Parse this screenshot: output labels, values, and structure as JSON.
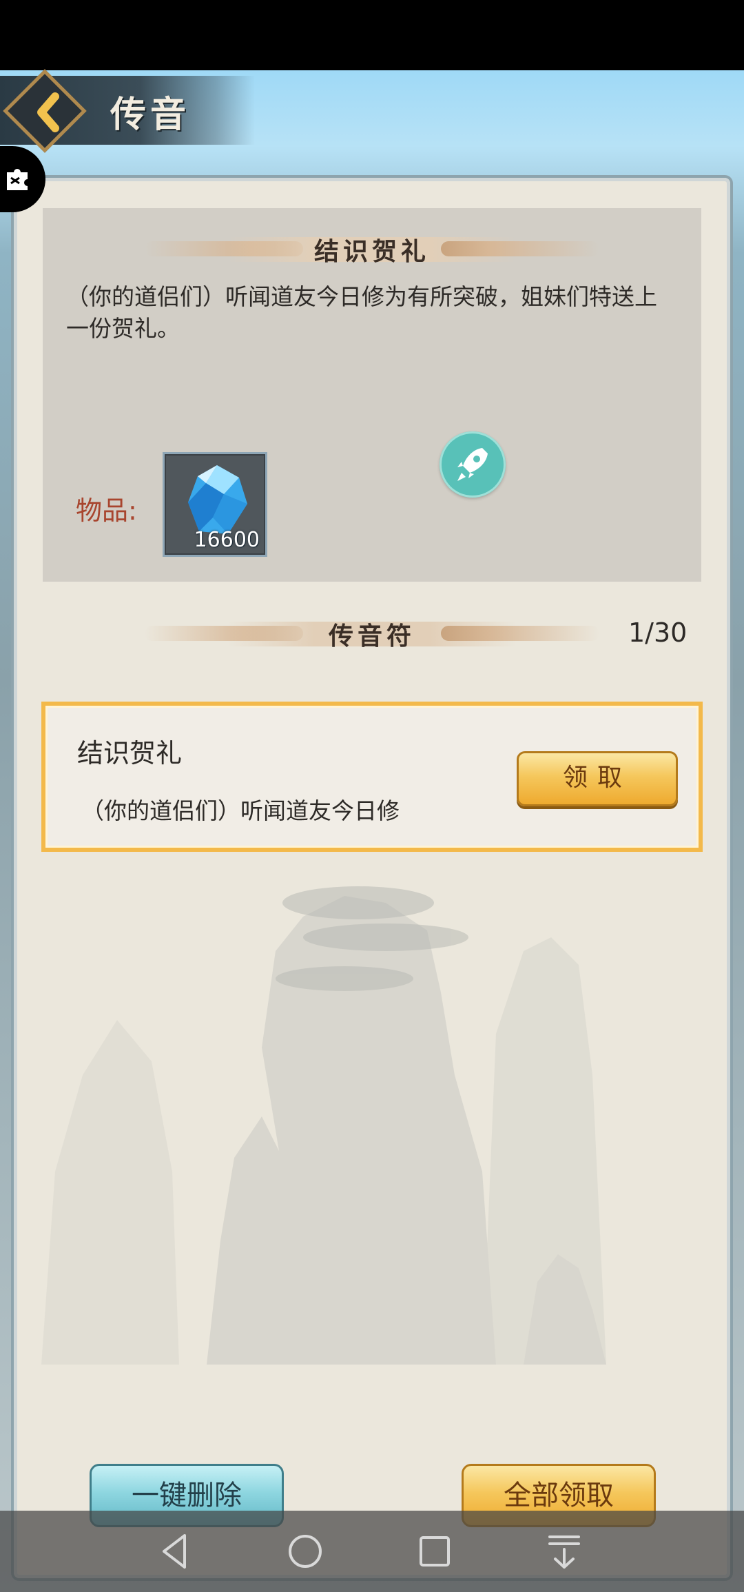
{
  "header": {
    "title": "传音",
    "back_icon": "chevron-left-icon"
  },
  "floating_widget": {
    "icon": "puzzle-icon"
  },
  "message": {
    "section_title": "结识贺礼",
    "body": "（你的道侣们）听闻道友今日修为有所突破，姐妹们特送上一份贺礼。",
    "items_label": "物品:",
    "items": [
      {
        "icon": "blue-crystal-icon",
        "count": "16600"
      }
    ],
    "rocket_icon": "rocket-icon"
  },
  "mailbox": {
    "section_title": "传音符",
    "counter": "1/30",
    "mails": [
      {
        "title": "结识贺礼",
        "preview": "（你的道侣们）听闻道友今日修",
        "claim_label": "领取"
      }
    ]
  },
  "actions": {
    "delete_all_label": "一键删除",
    "claim_all_label": "全部领取"
  },
  "system_nav": {
    "buttons": [
      "back-triangle-icon",
      "home-circle-icon",
      "recents-square-icon",
      "notification-down-icon"
    ]
  },
  "colors": {
    "items_label": "#a8452e",
    "selected_border": "#f3b94a",
    "claim_gold": "#f5c75c",
    "delete_teal": "#8ed6e0"
  }
}
